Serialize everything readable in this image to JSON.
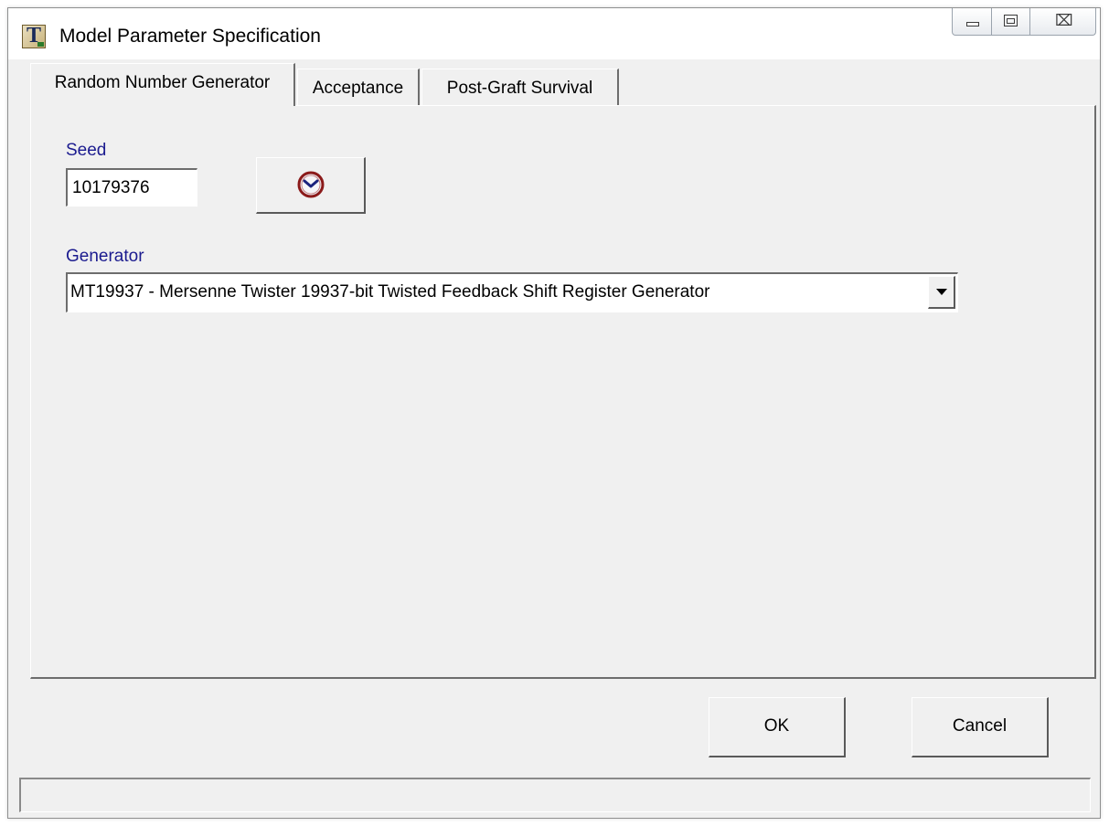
{
  "window": {
    "title": "Model Parameter Specification",
    "app_icon_letter": "T"
  },
  "caption_buttons": {
    "minimize": "minimize-icon",
    "restore": "restore-icon",
    "close": "close-icon"
  },
  "tabs": [
    {
      "label": "Random Number Generator",
      "active": true
    },
    {
      "label": "Acceptance",
      "active": false
    },
    {
      "label": "Post-Graft Survival",
      "active": false
    }
  ],
  "rng": {
    "seed_label": "Seed",
    "seed_value": "10179376",
    "clock_button_icon": "clock-icon",
    "generator_label": "Generator",
    "generator_value": "MT19937 - Mersenne Twister 19937-bit Twisted Feedback Shift Register Generator"
  },
  "buttons": {
    "ok_label": "OK",
    "cancel_label": "Cancel"
  },
  "status_bar": {
    "text": ""
  },
  "colors": {
    "label_blue": "#1b1b8f",
    "window_bg": "#f0f0f0",
    "clock_rim": "#8b1a1a",
    "clock_hands": "#1a237e"
  }
}
